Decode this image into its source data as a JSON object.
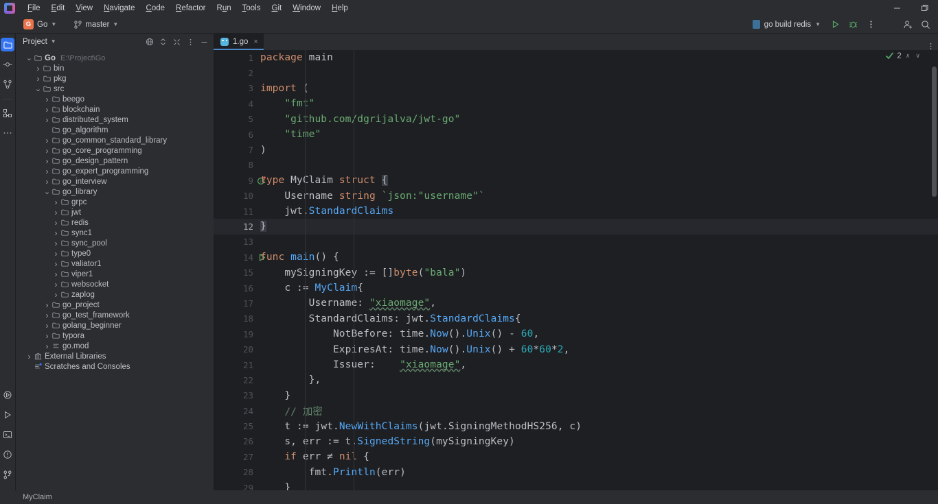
{
  "window": {
    "minimize_label": "minimize-icon",
    "maximize_label": "restore-icon"
  },
  "menubar": {
    "items": [
      {
        "label": "File",
        "mnemonic": "F"
      },
      {
        "label": "Edit",
        "mnemonic": "E"
      },
      {
        "label": "View",
        "mnemonic": "V"
      },
      {
        "label": "Navigate",
        "mnemonic": "N"
      },
      {
        "label": "Code",
        "mnemonic": "C"
      },
      {
        "label": "Refactor",
        "mnemonic": "R"
      },
      {
        "label": "Run",
        "mnemonic": "u"
      },
      {
        "label": "Tools",
        "mnemonic": "T"
      },
      {
        "label": "Git",
        "mnemonic": "G"
      },
      {
        "label": "Window",
        "mnemonic": "W"
      },
      {
        "label": "Help",
        "mnemonic": "H"
      }
    ]
  },
  "toolbar": {
    "project_badge": "G",
    "project_name": "Go",
    "branch_name": "master",
    "run_config": "go build redis",
    "run_label": "Run",
    "debug_label": "Debug",
    "more_label": "More",
    "account_label": "Account",
    "search_label": "Search Everywhere"
  },
  "tool_strip": {
    "top": [
      {
        "name": "project-icon",
        "label": "Project",
        "active": true
      },
      {
        "name": "commit-icon",
        "label": "Commit",
        "active": false
      },
      {
        "name": "pull-requests-icon",
        "label": "Pull Requests",
        "active": false
      },
      {
        "name": "structure-icon",
        "label": "Structure",
        "active": false
      },
      {
        "name": "more-tool-windows-icon",
        "label": "More Tool Windows",
        "active": false
      }
    ],
    "bottom": [
      {
        "name": "debug-icon",
        "label": "Debug"
      },
      {
        "name": "run-icon",
        "label": "Run"
      },
      {
        "name": "terminal-icon",
        "label": "Terminal"
      },
      {
        "name": "problems-icon",
        "label": "Problems"
      },
      {
        "name": "git-icon",
        "label": "Git"
      }
    ]
  },
  "panel": {
    "title": "Project",
    "actions": [
      "globe-icon",
      "expand-collapse-icon",
      "collapse-all-icon",
      "options-icon",
      "hide-icon"
    ],
    "tree": [
      {
        "indent": 0,
        "arrow": "down",
        "icon": "folder",
        "label": "Go",
        "bold": true,
        "path": "E:\\Project\\Go"
      },
      {
        "indent": 1,
        "arrow": "right",
        "icon": "folder",
        "label": "bin"
      },
      {
        "indent": 1,
        "arrow": "right",
        "icon": "folder",
        "label": "pkg"
      },
      {
        "indent": 1,
        "arrow": "down",
        "icon": "folder",
        "label": "src"
      },
      {
        "indent": 2,
        "arrow": "right",
        "icon": "folder",
        "label": "beego"
      },
      {
        "indent": 2,
        "arrow": "right",
        "icon": "folder",
        "label": "blockchain"
      },
      {
        "indent": 2,
        "arrow": "right",
        "icon": "folder",
        "label": "distributed_system"
      },
      {
        "indent": 2,
        "arrow": "none",
        "icon": "folder",
        "label": "go_algorithm"
      },
      {
        "indent": 2,
        "arrow": "right",
        "icon": "folder",
        "label": "go_common_standard_library"
      },
      {
        "indent": 2,
        "arrow": "right",
        "icon": "folder",
        "label": "go_core_programming"
      },
      {
        "indent": 2,
        "arrow": "right",
        "icon": "folder",
        "label": "go_design_pattern"
      },
      {
        "indent": 2,
        "arrow": "right",
        "icon": "folder",
        "label": "go_expert_programming"
      },
      {
        "indent": 2,
        "arrow": "right",
        "icon": "folder",
        "label": "go_interview"
      },
      {
        "indent": 2,
        "arrow": "down",
        "icon": "folder",
        "label": "go_library"
      },
      {
        "indent": 3,
        "arrow": "right",
        "icon": "folder",
        "label": "grpc"
      },
      {
        "indent": 3,
        "arrow": "right",
        "icon": "folder",
        "label": "jwt"
      },
      {
        "indent": 3,
        "arrow": "right",
        "icon": "folder",
        "label": "redis"
      },
      {
        "indent": 3,
        "arrow": "right",
        "icon": "folder",
        "label": "sync1"
      },
      {
        "indent": 3,
        "arrow": "right",
        "icon": "folder",
        "label": "sync_pool"
      },
      {
        "indent": 3,
        "arrow": "right",
        "icon": "folder",
        "label": "type0"
      },
      {
        "indent": 3,
        "arrow": "right",
        "icon": "folder",
        "label": "valiator1"
      },
      {
        "indent": 3,
        "arrow": "right",
        "icon": "folder",
        "label": "viper1"
      },
      {
        "indent": 3,
        "arrow": "right",
        "icon": "folder",
        "label": "websocket"
      },
      {
        "indent": 3,
        "arrow": "right",
        "icon": "folder",
        "label": "zaplog"
      },
      {
        "indent": 2,
        "arrow": "right",
        "icon": "folder",
        "label": "go_project"
      },
      {
        "indent": 2,
        "arrow": "right",
        "icon": "folder",
        "label": "go_test_framework"
      },
      {
        "indent": 2,
        "arrow": "right",
        "icon": "folder",
        "label": "golang_beginner"
      },
      {
        "indent": 2,
        "arrow": "right",
        "icon": "folder",
        "label": "typora"
      },
      {
        "indent": 2,
        "arrow": "right",
        "icon": "file",
        "label": "go.mod"
      },
      {
        "indent": 0,
        "arrow": "right",
        "icon": "library",
        "label": "External Libraries"
      },
      {
        "indent": 0,
        "arrow": "none",
        "icon": "scratch",
        "label": "Scratches and Consoles"
      }
    ]
  },
  "editor": {
    "tab": {
      "label": "1.go",
      "icon": "go-file-icon",
      "close": "×"
    },
    "inspection": {
      "status": "ok",
      "count": "2",
      "up": "∧",
      "down": "∨"
    },
    "current_line": 12,
    "gutter_marks": [
      {
        "line": 9,
        "name": "implementation-marker-icon"
      },
      {
        "line": 14,
        "name": "run-function-icon"
      }
    ],
    "lines": [
      {
        "n": 1,
        "tokens": [
          {
            "t": "kw",
            "s": "package"
          },
          {
            "t": "plain",
            "s": " "
          },
          {
            "t": "ident",
            "s": "main"
          }
        ]
      },
      {
        "n": 2,
        "tokens": []
      },
      {
        "n": 3,
        "tokens": [
          {
            "t": "kw",
            "s": "import"
          },
          {
            "t": "plain",
            "s": " "
          },
          {
            "t": "punc",
            "s": "("
          }
        ]
      },
      {
        "n": 4,
        "tokens": [
          {
            "t": "plain",
            "s": "    "
          },
          {
            "t": "str",
            "s": "\"fmt\""
          }
        ]
      },
      {
        "n": 5,
        "tokens": [
          {
            "t": "plain",
            "s": "    "
          },
          {
            "t": "str",
            "s": "\"github.com/dgrijalva/jwt-go\""
          }
        ]
      },
      {
        "n": 6,
        "tokens": [
          {
            "t": "plain",
            "s": "    "
          },
          {
            "t": "str",
            "s": "\"time\""
          }
        ]
      },
      {
        "n": 7,
        "tokens": [
          {
            "t": "punc",
            "s": ")"
          }
        ]
      },
      {
        "n": 8,
        "tokens": []
      },
      {
        "n": 9,
        "tokens": [
          {
            "t": "kw",
            "s": "type"
          },
          {
            "t": "plain",
            "s": " "
          },
          {
            "t": "ident",
            "s": "MyClaim"
          },
          {
            "t": "plain",
            "s": " "
          },
          {
            "t": "kw",
            "s": "struct"
          },
          {
            "t": "plain",
            "s": " "
          },
          {
            "t": "brace",
            "s": "{"
          }
        ]
      },
      {
        "n": 10,
        "tokens": [
          {
            "t": "plain",
            "s": "    "
          },
          {
            "t": "ident",
            "s": "Username"
          },
          {
            "t": "plain",
            "s": " "
          },
          {
            "t": "kw",
            "s": "string"
          },
          {
            "t": "plain",
            "s": " "
          },
          {
            "t": "tag",
            "s": "`json:"
          },
          {
            "t": "str",
            "s": "\"username\""
          },
          {
            "t": "tag",
            "s": "`"
          }
        ]
      },
      {
        "n": 11,
        "tokens": [
          {
            "t": "plain",
            "s": "    "
          },
          {
            "t": "pkgref",
            "s": "jwt"
          },
          {
            "t": "punc",
            "s": "."
          },
          {
            "t": "typeref",
            "s": "StandardClaims"
          }
        ]
      },
      {
        "n": 12,
        "tokens": [
          {
            "t": "brace",
            "s": "}"
          }
        ],
        "current": true
      },
      {
        "n": 13,
        "tokens": []
      },
      {
        "n": 14,
        "tokens": [
          {
            "t": "kw",
            "s": "func"
          },
          {
            "t": "plain",
            "s": " "
          },
          {
            "t": "fn",
            "s": "main"
          },
          {
            "t": "punc",
            "s": "() {"
          }
        ]
      },
      {
        "n": 15,
        "tokens": [
          {
            "t": "plain",
            "s": "    "
          },
          {
            "t": "ident",
            "s": "mySigningKey := []"
          },
          {
            "t": "kw",
            "s": "byte"
          },
          {
            "t": "punc",
            "s": "("
          },
          {
            "t": "str",
            "s": "\"bala\""
          },
          {
            "t": "punc",
            "s": ")"
          }
        ]
      },
      {
        "n": 16,
        "tokens": [
          {
            "t": "plain",
            "s": "    "
          },
          {
            "t": "ident",
            "s": "c := "
          },
          {
            "t": "typeref",
            "s": "MyClaim"
          },
          {
            "t": "punc",
            "s": "{"
          }
        ]
      },
      {
        "n": 17,
        "tokens": [
          {
            "t": "plain",
            "s": "        "
          },
          {
            "t": "ident",
            "s": "Username: "
          },
          {
            "t": "strtypo",
            "s": "\"xiaomage\""
          },
          {
            "t": "punc",
            "s": ","
          }
        ]
      },
      {
        "n": 18,
        "tokens": [
          {
            "t": "plain",
            "s": "        "
          },
          {
            "t": "ident",
            "s": "StandardClaims: "
          },
          {
            "t": "pkgref",
            "s": "jwt"
          },
          {
            "t": "punc",
            "s": "."
          },
          {
            "t": "typeref",
            "s": "StandardClaims"
          },
          {
            "t": "punc",
            "s": "{"
          }
        ]
      },
      {
        "n": 19,
        "tokens": [
          {
            "t": "plain",
            "s": "            "
          },
          {
            "t": "ident",
            "s": "NotBefore: "
          },
          {
            "t": "pkgref",
            "s": "time"
          },
          {
            "t": "punc",
            "s": "."
          },
          {
            "t": "typeref",
            "s": "Now"
          },
          {
            "t": "punc",
            "s": "()."
          },
          {
            "t": "typeref",
            "s": "Unix"
          },
          {
            "t": "punc",
            "s": "() - "
          },
          {
            "t": "num",
            "s": "60"
          },
          {
            "t": "punc",
            "s": ","
          }
        ]
      },
      {
        "n": 20,
        "tokens": [
          {
            "t": "plain",
            "s": "            "
          },
          {
            "t": "ident",
            "s": "ExpiresAt: "
          },
          {
            "t": "pkgref",
            "s": "time"
          },
          {
            "t": "punc",
            "s": "."
          },
          {
            "t": "typeref",
            "s": "Now"
          },
          {
            "t": "punc",
            "s": "()."
          },
          {
            "t": "typeref",
            "s": "Unix"
          },
          {
            "t": "punc",
            "s": "() + "
          },
          {
            "t": "num",
            "s": "60"
          },
          {
            "t": "punc",
            "s": "*"
          },
          {
            "t": "num",
            "s": "60"
          },
          {
            "t": "punc",
            "s": "*"
          },
          {
            "t": "num",
            "s": "2"
          },
          {
            "t": "punc",
            "s": ","
          }
        ]
      },
      {
        "n": 21,
        "tokens": [
          {
            "t": "plain",
            "s": "            "
          },
          {
            "t": "ident",
            "s": "Issuer:    "
          },
          {
            "t": "strtypo",
            "s": "\"xiaomage\""
          },
          {
            "t": "punc",
            "s": ","
          }
        ]
      },
      {
        "n": 22,
        "tokens": [
          {
            "t": "plain",
            "s": "        "
          },
          {
            "t": "punc",
            "s": "},"
          }
        ]
      },
      {
        "n": 23,
        "tokens": [
          {
            "t": "plain",
            "s": "    "
          },
          {
            "t": "punc",
            "s": "}"
          }
        ]
      },
      {
        "n": 24,
        "tokens": [
          {
            "t": "plain",
            "s": "    "
          },
          {
            "t": "com",
            "s": "// 加密"
          }
        ]
      },
      {
        "n": 25,
        "tokens": [
          {
            "t": "plain",
            "s": "    "
          },
          {
            "t": "ident",
            "s": "t := "
          },
          {
            "t": "pkgref",
            "s": "jwt"
          },
          {
            "t": "punc",
            "s": "."
          },
          {
            "t": "typeref",
            "s": "NewWithClaims"
          },
          {
            "t": "punc",
            "s": "("
          },
          {
            "t": "pkgref",
            "s": "jwt"
          },
          {
            "t": "punc",
            "s": "."
          },
          {
            "t": "ident",
            "s": "SigningMethodHS256"
          },
          {
            "t": "punc",
            "s": ", c)"
          }
        ]
      },
      {
        "n": 26,
        "tokens": [
          {
            "t": "plain",
            "s": "    "
          },
          {
            "t": "ident",
            "s": "s, err := t."
          },
          {
            "t": "typeref",
            "s": "SignedString"
          },
          {
            "t": "punc",
            "s": "(mySigningKey)"
          }
        ]
      },
      {
        "n": 27,
        "tokens": [
          {
            "t": "kwpad",
            "s": "    if"
          },
          {
            "t": "plain",
            "s": " "
          },
          {
            "t": "ident",
            "s": "err "
          },
          {
            "t": "punc",
            "s": "≠"
          },
          {
            "t": "plain",
            "s": " "
          },
          {
            "t": "kw",
            "s": "nil"
          },
          {
            "t": "punc",
            "s": " {"
          }
        ]
      },
      {
        "n": 28,
        "tokens": [
          {
            "t": "plain",
            "s": "        "
          },
          {
            "t": "pkgref",
            "s": "fmt"
          },
          {
            "t": "punc",
            "s": "."
          },
          {
            "t": "typeref",
            "s": "Println"
          },
          {
            "t": "punc",
            "s": "(err)"
          }
        ]
      },
      {
        "n": 29,
        "tokens": [
          {
            "t": "plain",
            "s": "    "
          },
          {
            "t": "punc",
            "s": "}"
          }
        ]
      }
    ]
  },
  "statusbar": {
    "breadcrumb": "MyClaim"
  },
  "colors": {
    "bg": "#1e1f22",
    "chrome": "#2b2d30",
    "accent": "#3574f0",
    "keyword": "#cf8e6d",
    "string": "#6aab73",
    "number": "#2aacb8",
    "function": "#56a8f5",
    "comment": "#5f826b",
    "text": "#bcbec4",
    "run_green": "#59a869",
    "branch_orange": "#e8744d"
  }
}
